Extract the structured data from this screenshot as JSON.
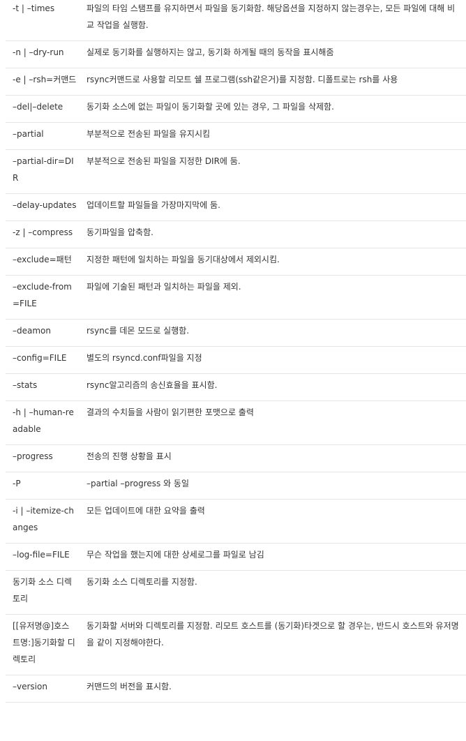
{
  "rows": [
    {
      "option": "-t | –times",
      "desc": "파일의 타임 스탬프를 유지하면서 파일을 동기화함. 해당옵션을 지정하지 않는경우는, 모든 파일에 대해 비교 작업을 실행함."
    },
    {
      "option": "-n | –dry-run",
      "desc": "실제로 동기화를 실행하지는 않고, 동기화 하게될 때의 동작을 표시해줌"
    },
    {
      "option": "-e | –rsh=커맨드",
      "desc": "rsync커맨드로 사용할 리모트 쉘 프로그램(ssh같은거)를 지정함. 디폴트로는 rsh를 사용"
    },
    {
      "option": "–del|–delete",
      "desc": "동기화 소스에 없는 파일이 동기화할 곳에 있는 경우, 그 파일을 삭제함."
    },
    {
      "option": "–partial",
      "desc": "부분적으로 전송된 파일을 유지시킴"
    },
    {
      "option": "–partial-dir=DIR",
      "desc": "부분적으로 전송된 파일을 지정한 DIR에 둠."
    },
    {
      "option": "–delay-updates",
      "desc": "업데이트할 파일들을 가장마지막에 둠."
    },
    {
      "option": "-z | –compress",
      "desc": "동기파일을 압축함."
    },
    {
      "option": "–exclude=패턴",
      "desc": "지정한 패턴에 일치하는 파일을 동기대상에서 제외시킴."
    },
    {
      "option": "–exclude-from=FILE",
      "desc": "파일에 기술된 패턴과 일치하는 파일을 제외."
    },
    {
      "option": "–deamon",
      "desc": "rsync를 데몬 모드로 실행함."
    },
    {
      "option": "–config=FILE",
      "desc": "별도의 rsyncd.conf파일을 지정"
    },
    {
      "option": "–stats",
      "desc": "rsync알고리즘의 송신효율을 표시함."
    },
    {
      "option": "-h | –human-readable",
      "desc": "결과의 수치들을 사람이 읽기편한 포맷으로 출력"
    },
    {
      "option": "–progress",
      "desc": "전송의 진행 상황을 표시"
    },
    {
      "option": "-P",
      "desc": "–partial –progress 와 동일"
    },
    {
      "option": "-i | –itemize-changes",
      "desc": "모든 업데이트에 대한 요약을 출력"
    },
    {
      "option": "–log-file=FILE",
      "desc": "무슨 작업을 했는지에 대한 상세로그를 파일로 남김"
    },
    {
      "option": "동기화 소스 디렉토리",
      "desc": "동기화 소스 디렉토리를 지정함."
    },
    {
      "option": "[[유저명@]호스트명:]동기화할 디렉토리",
      "desc": "동기화할 서버와 디렉토리를 지정함. 리모트 호스트를 (동기화)타겟으로 할 경우는, 반드시 호스트와 유저명을 같이 지정해야한다."
    },
    {
      "option": "–version",
      "desc": "커맨드의 버전을 표시함."
    }
  ]
}
